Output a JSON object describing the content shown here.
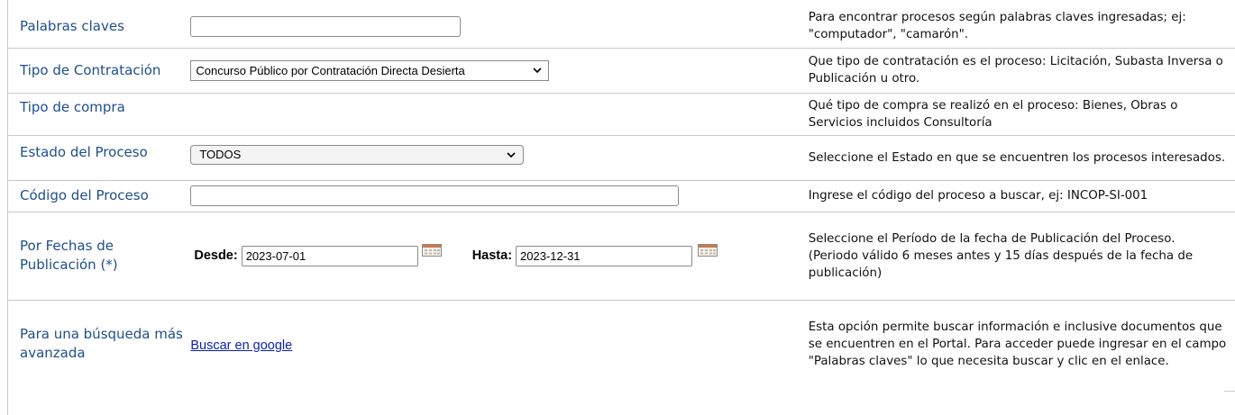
{
  "rows": {
    "keywords": {
      "label": "Palabras claves",
      "value": "",
      "help": "Para encontrar procesos según palabras claves ingresadas; ej: \"computador\", \"camarón\"."
    },
    "contract_type": {
      "label": "Tipo de Contratación",
      "selected": "Concurso Público por Contratación Directa Desierta",
      "help": "Que tipo de contratación es el proceso: Licitación, Subasta Inversa o Publicación u otro."
    },
    "purchase_type": {
      "label": "Tipo de compra",
      "help": "Qué tipo de compra se realizó en el proceso: Bienes, Obras o Servicios incluidos Consultoría"
    },
    "process_state": {
      "label": "Estado del Proceso",
      "selected": "TODOS",
      "help": "Seleccione el Estado en que se encuentren los procesos interesados."
    },
    "process_code": {
      "label": "Código del Proceso",
      "value": "",
      "help": "Ingrese el código del proceso a buscar, ej: INCOP-SI-001"
    },
    "publication_dates": {
      "label": "Por Fechas de Publicación (*)",
      "from_label": "Desde:",
      "from_value": "2023-07-01",
      "to_label": "Hasta:",
      "to_value": "2023-12-31",
      "help_line1": "Seleccione el Período de la fecha de Publicación del Proceso.",
      "help_line2": "(Periodo válido 6 meses antes y 15 días después de la fecha de publicación)"
    },
    "advanced": {
      "label": "Para una búsqueda más avanzada",
      "link": "Buscar en google",
      "help": "Esta opción permite buscar información e inclusive documentos que se encuentren en el Portal. Para acceder puede ingresar en el campo \"Palabras claves\" lo que necesita buscar y clic en el enlace."
    }
  },
  "icons": {
    "select_arrow": "chevron-down-icon",
    "date_picker": "calendar-icon"
  },
  "colors": {
    "label_text": "#1f4e8c",
    "link": "#0b1fb4",
    "row_divider": "#c9c9c9"
  }
}
